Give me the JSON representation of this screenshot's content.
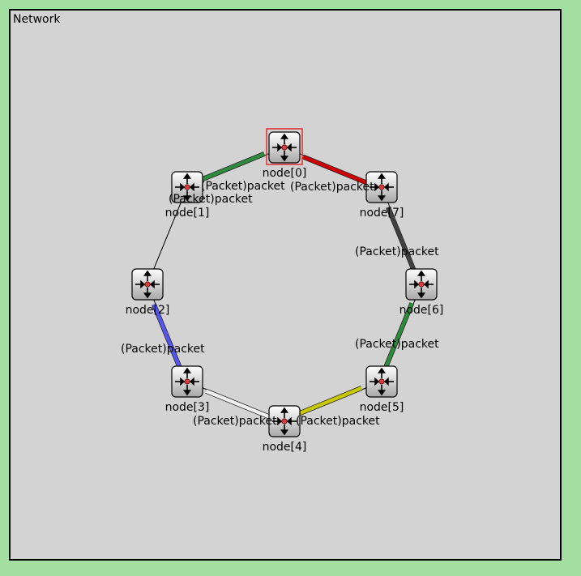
{
  "network": {
    "title": "Network",
    "nodes": [
      {
        "id": 0,
        "label": "node[0]",
        "selected": true
      },
      {
        "id": 1,
        "label": "node[1]"
      },
      {
        "id": 2,
        "label": "node[2]"
      },
      {
        "id": 3,
        "label": "node[3]"
      },
      {
        "id": 4,
        "label": "node[4]"
      },
      {
        "id": 5,
        "label": "node[5]"
      },
      {
        "id": 6,
        "label": "node[6]"
      },
      {
        "id": 7,
        "label": "node[7]"
      }
    ],
    "links": [
      {
        "from": 0,
        "to": 1,
        "color": "#2e8b3e",
        "label": "(Packet)packet"
      },
      {
        "from": 1,
        "to": 0,
        "color": null,
        "label": "(Packet)packet"
      },
      {
        "from": 0,
        "to": 7,
        "color": "#cc0000",
        "label": "(Packet)packet"
      },
      {
        "from": 7,
        "to": 6,
        "color": "#404040",
        "label": "(Packet)packet"
      },
      {
        "from": 6,
        "to": 5,
        "color": "#2e8b3e",
        "label": "(Packet)packet"
      },
      {
        "from": 5,
        "to": 4,
        "color": "#c8c800",
        "label": "(Packet)packet"
      },
      {
        "from": 3,
        "to": 4,
        "color": "#f0f0f0",
        "label": "(Packet)packet"
      },
      {
        "from": 2,
        "to": 3,
        "color": "#5555ee",
        "label": "(Packet)packet"
      },
      {
        "from": 1,
        "to": 2,
        "color": null,
        "label": ""
      }
    ],
    "colors": {
      "background": "#a3dfa0",
      "canvas": "#d3d3d3",
      "selection": "#e03030"
    }
  }
}
